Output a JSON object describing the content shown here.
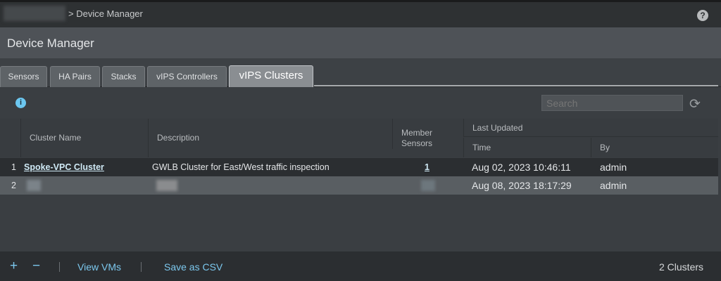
{
  "breadcrumb": {
    "current": "> Device Manager"
  },
  "header": {
    "title": "Device Manager",
    "help": "?"
  },
  "tabs": [
    {
      "label": "Sensors"
    },
    {
      "label": "HA Pairs"
    },
    {
      "label": "Stacks"
    },
    {
      "label": "vIPS Controllers"
    },
    {
      "label": "vIPS Clusters",
      "active": true
    }
  ],
  "toolbar": {
    "info": "i",
    "search_placeholder": "Search",
    "refresh": "⟳"
  },
  "table": {
    "columns": {
      "name": "Cluster Name",
      "description": "Description",
      "members": "Member Sensors",
      "last_updated": "Last Updated",
      "time": "Time",
      "by": "By"
    },
    "rows": [
      {
        "index": "1",
        "name": "Spoke-VPC Cluster",
        "description": "GWLB Cluster for East/West traffic inspection",
        "members": "1",
        "time": "Aug 02, 2023 10:46:11",
        "by": "admin"
      },
      {
        "index": "2",
        "name": "",
        "description": "",
        "members": "",
        "time": "Aug 08, 2023 18:17:29",
        "by": "admin"
      }
    ]
  },
  "footer": {
    "add": "+",
    "remove": "−",
    "view_vms": "View VMs",
    "save_csv": "Save as CSV",
    "count": "2 Clusters"
  }
}
